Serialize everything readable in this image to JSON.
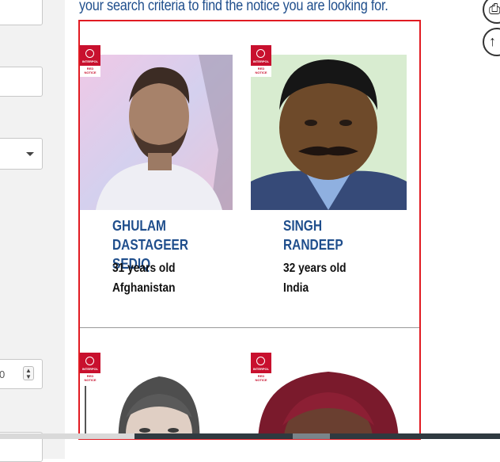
{
  "intro_text": "your search criteria to find the notice you are looking for.",
  "filters": {
    "number_partial": "0",
    "spin_up": "▲",
    "spin_down": "▼"
  },
  "floating": {
    "print_icon": "print-icon",
    "up_icon": "arrow-up-icon",
    "print_glyph": "⎙",
    "up_glyph": "↑"
  },
  "badge": {
    "line1": "INTERPOL",
    "line2": "RED",
    "line3": "NOTICE"
  },
  "notices": [
    {
      "name_line1": "GHULAM DASTAGEER",
      "name_line2": "SEDIQ",
      "age": "31 years old",
      "nationality": "Afghanistan"
    },
    {
      "name_line1": "SINGH",
      "name_line2": "RANDEEP",
      "age": "32 years old",
      "nationality": "India"
    },
    {
      "name_line1": "",
      "name_line2": "",
      "age": "",
      "nationality": ""
    },
    {
      "name_line1": "",
      "name_line2": "",
      "age": "",
      "nationality": ""
    }
  ],
  "colors": {
    "accent_red": "#e11b22",
    "name_blue": "#1f4e8c"
  }
}
